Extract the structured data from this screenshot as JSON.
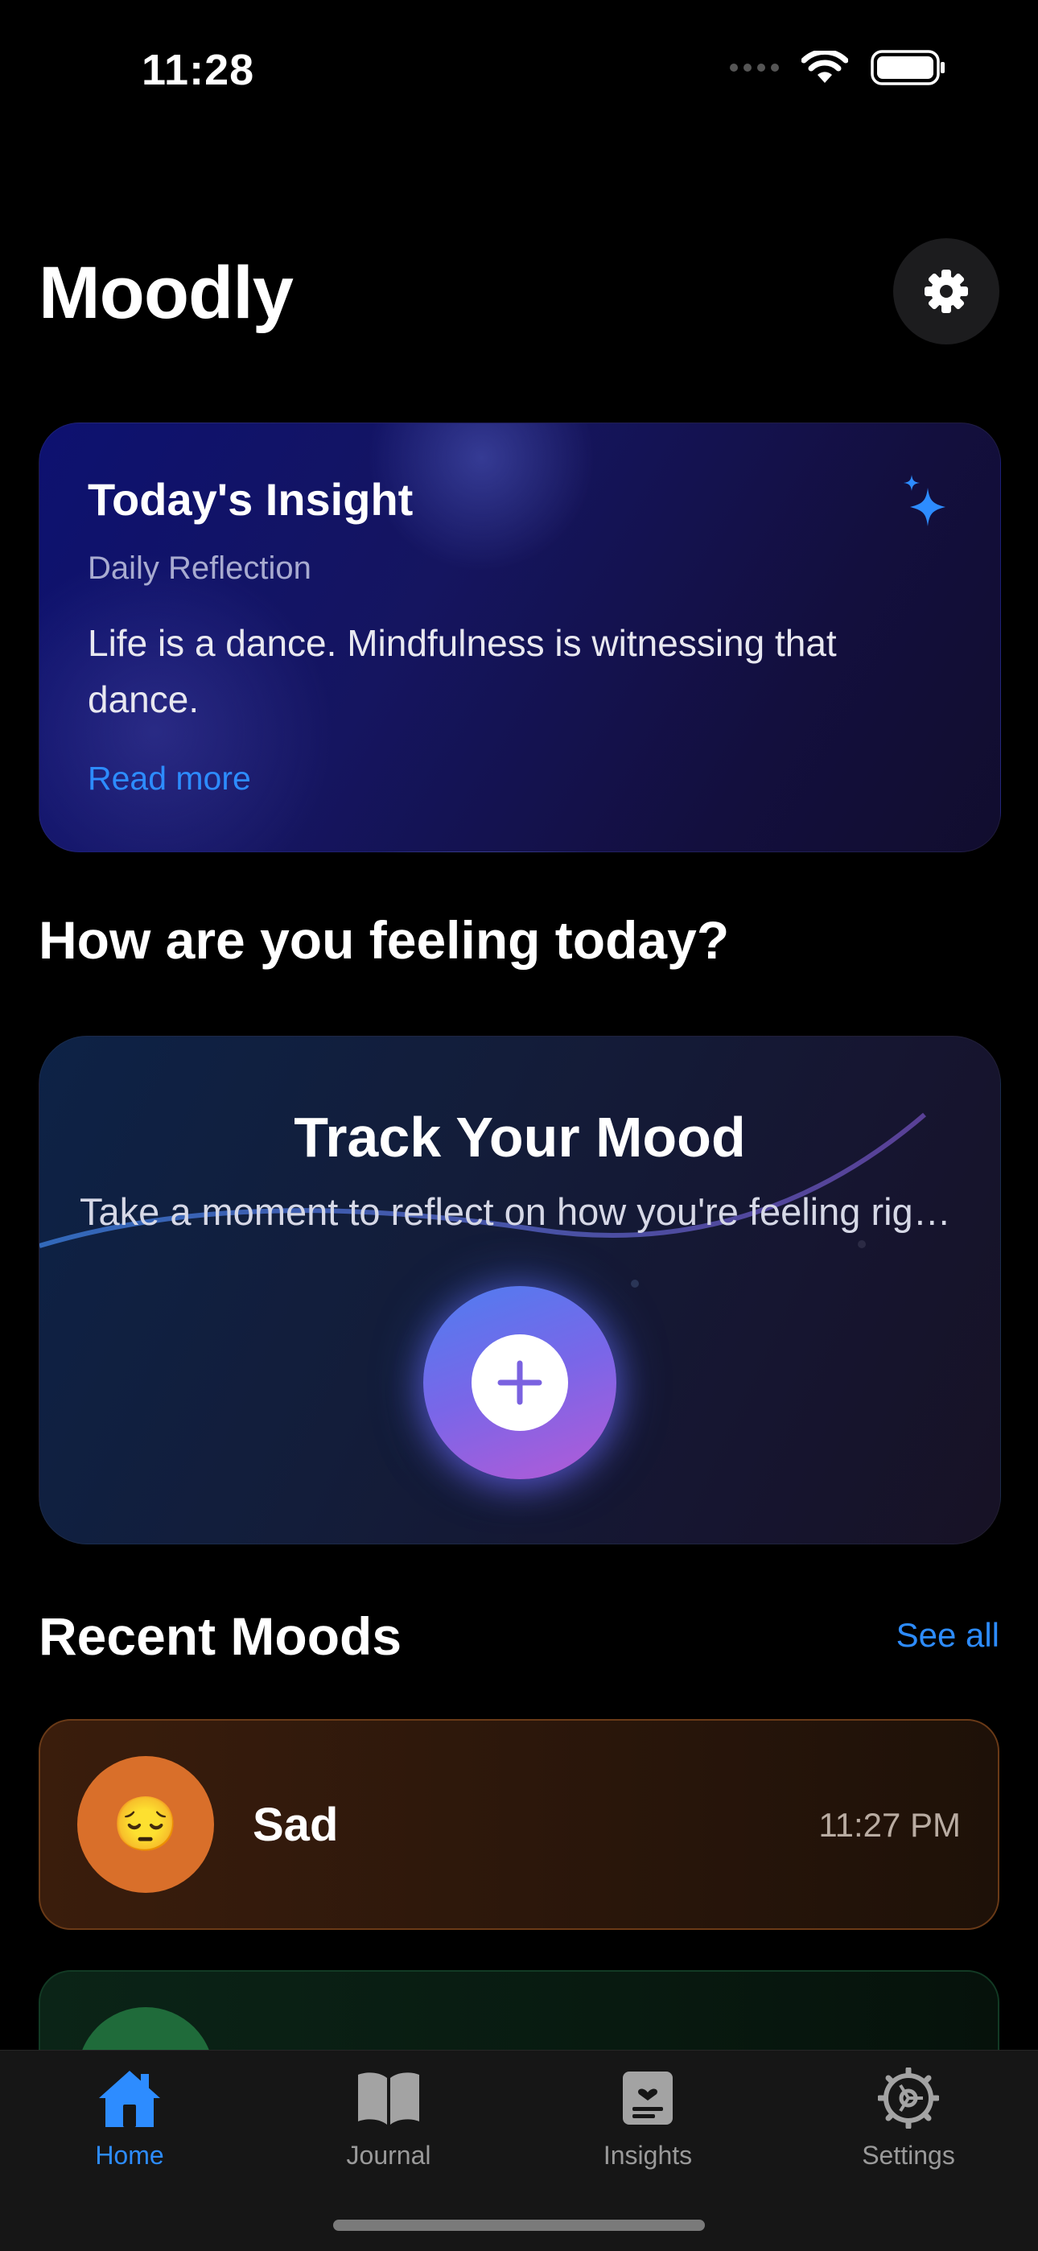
{
  "status_bar": {
    "time": "11:28"
  },
  "header": {
    "title": "Moodly",
    "settings_icon": "gear-icon"
  },
  "insight": {
    "title": "Today's Insight",
    "subtitle": "Daily Reflection",
    "text": "Life is a dance. Mindfulness is witnessing that dance.",
    "link": "Read more",
    "icon": "sparkles-icon"
  },
  "prompt": {
    "question": "How are you feeling today?"
  },
  "track": {
    "title": "Track Your Mood",
    "subtitle": "Take a moment to reflect on how you're feeling right now",
    "button_icon": "plus-icon"
  },
  "recent": {
    "title": "Recent Moods",
    "see_all": "See all",
    "items": [
      {
        "emoji": "😔",
        "label": "Sad",
        "time": "11:27 PM",
        "color": "#d96f2a"
      }
    ]
  },
  "tabs": [
    {
      "label": "Home",
      "icon": "house-icon",
      "active": true
    },
    {
      "label": "Journal",
      "icon": "book-icon",
      "active": false
    },
    {
      "label": "Insights",
      "icon": "journal-heart-icon",
      "active": false
    },
    {
      "label": "Settings",
      "icon": "gear-icon",
      "active": false
    }
  ],
  "colors": {
    "accent": "#2d8cff",
    "background": "#000000"
  }
}
